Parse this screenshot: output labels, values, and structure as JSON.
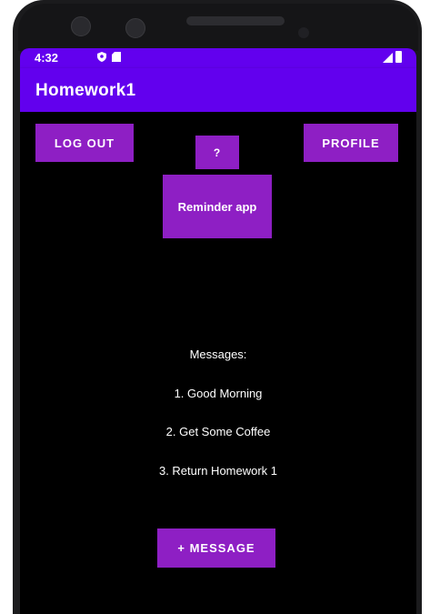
{
  "status_bar": {
    "time": "4:32",
    "background_color": "#6200ee",
    "icons": [
      "shield-icon",
      "sd-card-icon",
      "signal-icon",
      "battery-icon"
    ]
  },
  "app_bar": {
    "title": "Homework1",
    "background_color": "#6200ee"
  },
  "buttons": {
    "logout_label": "LOG OUT",
    "profile_label": "PROFILE",
    "help_label": "?",
    "reminder_label": "Reminder app",
    "add_message_label": "+ MESSAGE",
    "color": "#8e1fc4"
  },
  "messages": {
    "heading": "Messages:",
    "items": [
      "1. Good Morning",
      "2. Get Some Coffee",
      "3. Return Homework 1"
    ]
  }
}
